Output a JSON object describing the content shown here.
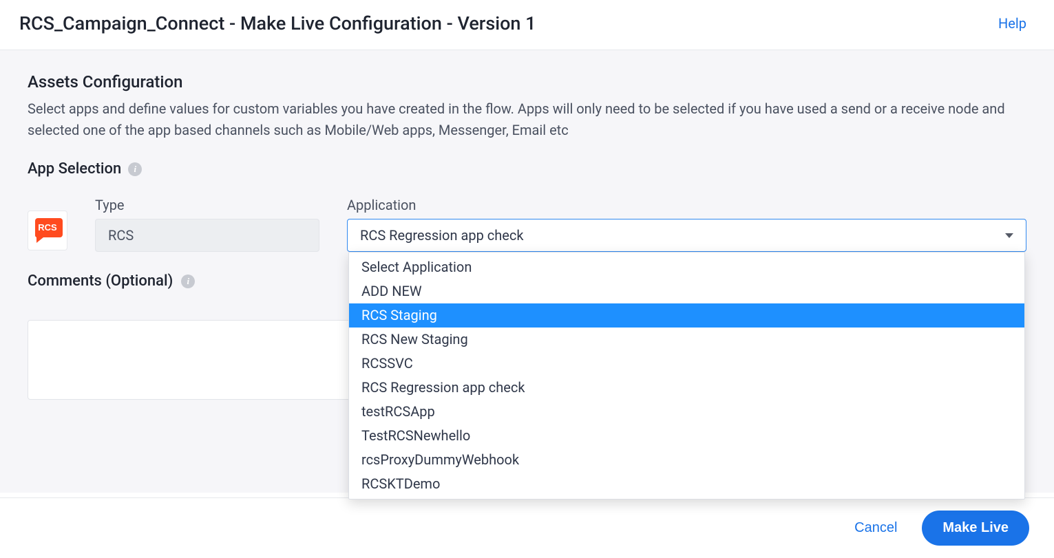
{
  "header": {
    "title": "RCS_Campaign_Connect - Make Live Configuration - Version 1",
    "help": "Help"
  },
  "assets": {
    "title": "Assets Configuration",
    "description": "Select apps and define values for custom variables you have created in the flow. Apps will only need to be selected if you have used a send or a receive node and selected one of the app based channels such as Mobile/Web apps, Messenger, Email etc"
  },
  "app_selection": {
    "label": "App Selection",
    "type_label": "Type",
    "type_value": "RCS",
    "application_label": "Application",
    "selected": "RCS Regression app check",
    "icon_text": "RCS",
    "options": [
      {
        "label": "Select Application",
        "highlight": false
      },
      {
        "label": "ADD NEW",
        "highlight": false
      },
      {
        "label": "RCS Staging",
        "highlight": true
      },
      {
        "label": "RCS New Staging",
        "highlight": false
      },
      {
        "label": "RCSSVC",
        "highlight": false
      },
      {
        "label": "RCS Regression app check",
        "highlight": false
      },
      {
        "label": "testRCSApp",
        "highlight": false
      },
      {
        "label": "TestRCSNewhello",
        "highlight": false
      },
      {
        "label": "rcsProxyDummyWebhook",
        "highlight": false
      },
      {
        "label": "RCSKTDemo",
        "highlight": false
      }
    ]
  },
  "comments": {
    "label": "Comments (Optional)",
    "value": ""
  },
  "footer": {
    "cancel": "Cancel",
    "make_live": "Make Live"
  }
}
